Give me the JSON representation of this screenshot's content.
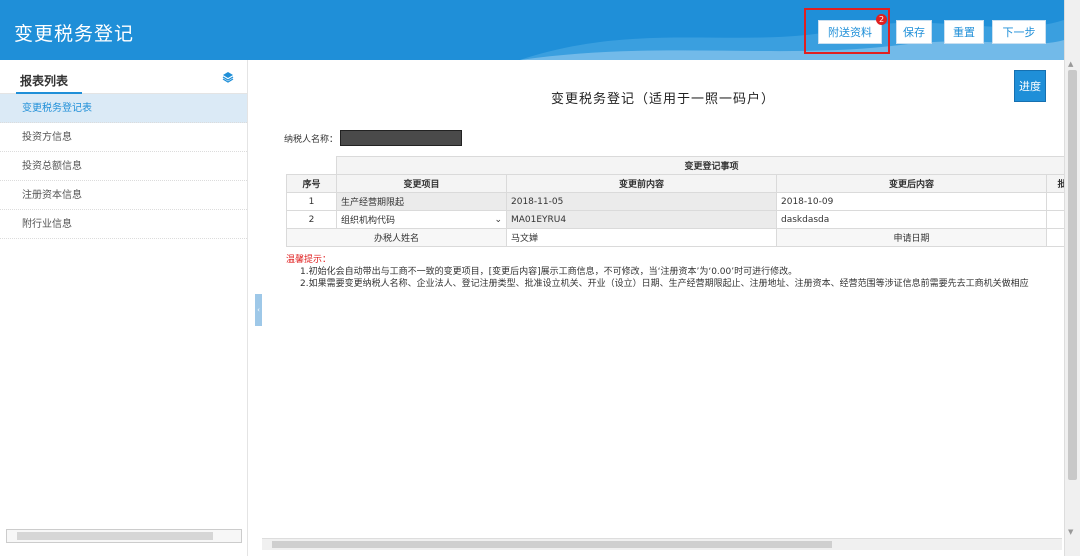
{
  "header": {
    "title": "变更税务登记",
    "buttons": {
      "attach": "附送资料",
      "save": "保存",
      "reset": "重置",
      "next": "下一步"
    },
    "attach_badge": "2"
  },
  "sidebar": {
    "title": "报表列表",
    "items": [
      {
        "label": "变更税务登记表",
        "active": true
      },
      {
        "label": "投资方信息"
      },
      {
        "label": "投资总额信息"
      },
      {
        "label": "注册资本信息"
      },
      {
        "label": "附行业信息"
      }
    ]
  },
  "main": {
    "page_title": "变更税务登记（适用于一照一码户）",
    "progress_label": "进度",
    "taxpayer_label": "纳税人名称：",
    "table": {
      "group_header": "变更登记事项",
      "columns": [
        "序号",
        "变更项目",
        "变更前内容",
        "变更后内容",
        "批准"
      ],
      "rows": [
        {
          "no": "1",
          "item": "生产经营期限起",
          "before": "2018-11-05",
          "after": "2018-10-09"
        },
        {
          "no": "2",
          "item": "组织机构代码",
          "before": "MA01EYRU4",
          "after": "daskdasda"
        }
      ],
      "handler_label": "办税人姓名",
      "handler_value": "马文婵",
      "apply_date_label": "申请日期"
    },
    "tips": {
      "heading": "温馨提示：",
      "line1": "1.初始化会自动带出与工商不一致的变更项目，[变更后内容]展示工商信息，不可修改，当‘注册资本’为‘0.00’时可进行修改。",
      "line2": "2.如果需要变更纳税人名称、企业法人、登记注册类型、批准设立机关、开业（设立）日期、生产经营期限起止、注册地址、注册资本、经营范围等涉证信息前需要先去工商机关做相应"
    }
  },
  "colors": {
    "primary": "#1f8fd8",
    "highlight": "#e02020"
  }
}
